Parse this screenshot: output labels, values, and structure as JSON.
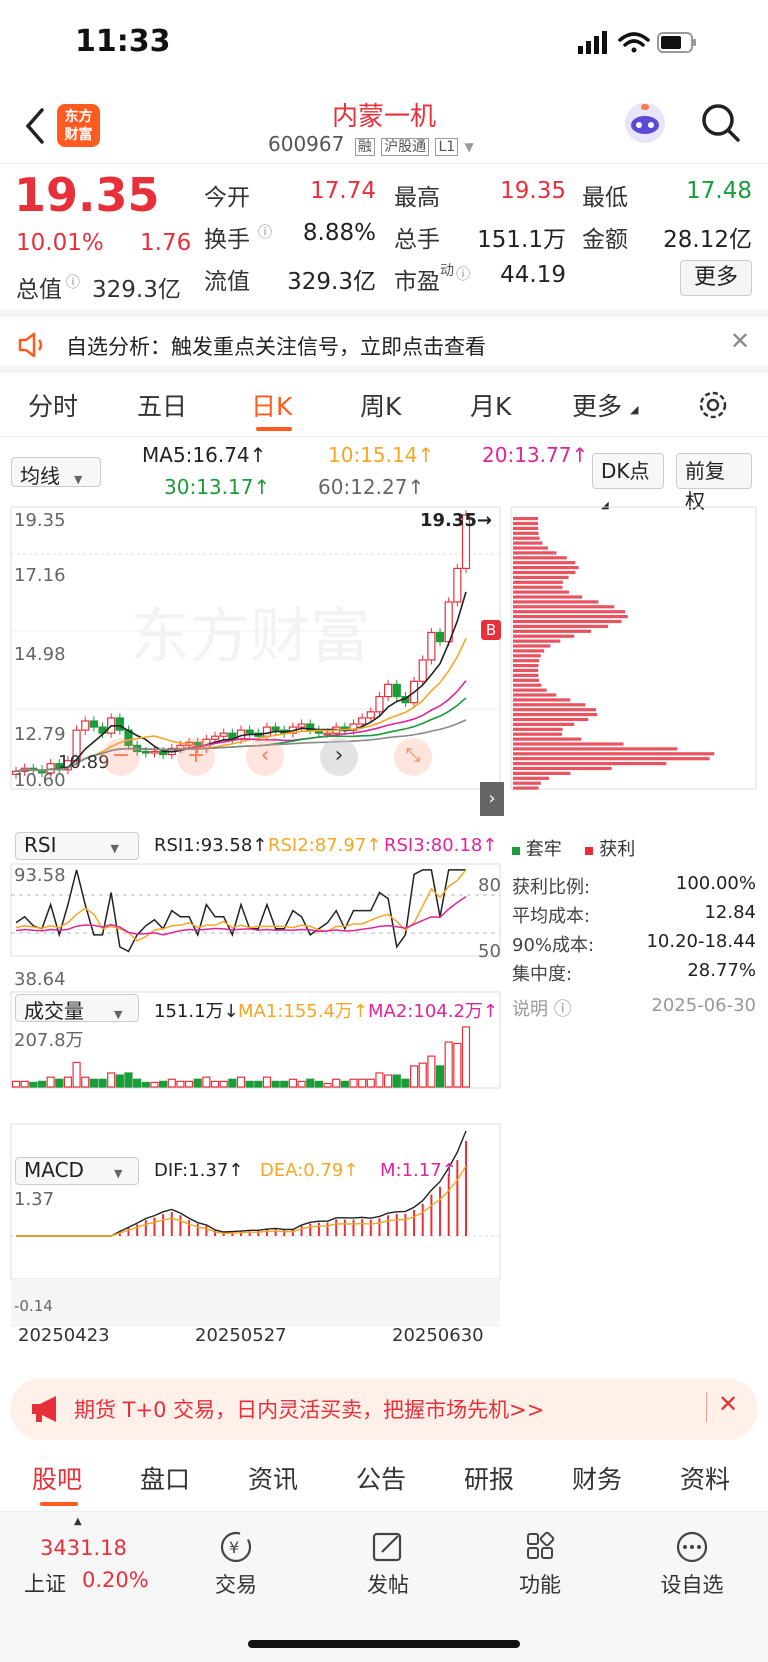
{
  "status_bar": {
    "time": "11:33"
  },
  "header": {
    "logo_text": "东方\n财富",
    "stock_name": "内蒙一机",
    "stock_code": "600967",
    "badges": [
      "融",
      "沪股通",
      "L1"
    ]
  },
  "quote": {
    "price": "19.35",
    "change_pct": "10.01%",
    "change": "1.76",
    "total_value_label": "总值",
    "total_value": "329.3亿",
    "rows": [
      [
        {
          "label": "今开",
          "value": "17.74",
          "color": "red"
        },
        {
          "label": "最高",
          "value": "19.35",
          "color": "red"
        },
        {
          "label": "最低",
          "value": "17.48",
          "color": "green"
        }
      ],
      [
        {
          "label": "换手",
          "value": "8.88%",
          "color": "dark"
        },
        {
          "label": "总手",
          "value": "151.1万",
          "color": "dark"
        },
        {
          "label": "金额",
          "value": "28.12亿",
          "color": "dark"
        }
      ],
      [
        {
          "label": "流值",
          "value": "329.3亿",
          "color": "dark"
        },
        {
          "label": "市盈",
          "value": "44.19",
          "color": "dark"
        }
      ]
    ],
    "pe_sup": "动",
    "more_label": "更多"
  },
  "notice": {
    "text": "自选分析：触发重点关注信号，立即点击查看"
  },
  "tabs": [
    "分时",
    "五日",
    "日K",
    "周K",
    "月K",
    "更多"
  ],
  "active_tab": 2,
  "ma_bar": {
    "select": "均线",
    "items": [
      {
        "text": "MA5:16.74↑",
        "color": "#222"
      },
      {
        "text": "10:15.14↑",
        "color": "#f5a623"
      },
      {
        "text": "20:13.77↑",
        "color": "#e0249c"
      },
      {
        "text": "30:13.17↑",
        "color": "#1a9c38"
      },
      {
        "text": "60:12.27↑",
        "color": "#666"
      }
    ],
    "dk_label": "DK点",
    "fq_label": "前复权"
  },
  "kline": {
    "y_labels": [
      "19.35",
      "17.16",
      "14.98",
      "12.79",
      "10.60"
    ],
    "low_mark": "10.89",
    "high_mark": "19.35→",
    "watermark": "东方财富",
    "b_marker": "B",
    "legend": [
      "套牢",
      "获利"
    ]
  },
  "chip_stats": [
    {
      "label": "获利比例:",
      "value": "100.00%"
    },
    {
      "label": "平均成本:",
      "value": "12.84"
    },
    {
      "label": "90%成本:",
      "value": "10.20-18.44"
    },
    {
      "label": "集中度:",
      "value": "28.77%"
    }
  ],
  "chip_note": {
    "label": "说明",
    "date": "2025-06-30"
  },
  "rsi": {
    "select": "RSI",
    "rsi1": "RSI1:93.58↑",
    "rsi2": "RSI2:87.97↑",
    "rsi3": "RSI3:80.18↑",
    "top": "93.58",
    "bottom": "38.64",
    "lvl80": "80",
    "lvl50": "50"
  },
  "volume": {
    "select": "成交量",
    "vol": "151.1万↓",
    "ma1": "MA1:155.4万↑",
    "ma2": "MA2:104.2万↑",
    "top": "207.8万"
  },
  "macd": {
    "select": "MACD",
    "dif": "DIF:1.37↑",
    "dea": "DEA:0.79↑",
    "m": "M:1.17↑",
    "top": "1.37",
    "bottom": "-0.14"
  },
  "dates": [
    "20250423",
    "20250527",
    "20250630"
  ],
  "promo": {
    "text": "期货 T+0 交易，日内灵活买卖，把握市场先机>>"
  },
  "bottom_tabs": [
    "股吧",
    "盘口",
    "资讯",
    "公告",
    "研报",
    "财务",
    "资料"
  ],
  "dock": {
    "index_value": "3431.18",
    "index_name": "上证",
    "index_change": "0.20%",
    "items": [
      "交易",
      "发帖",
      "功能",
      "设自选"
    ]
  },
  "colors": {
    "accent": "#ff5a1f",
    "up": "#e8303a",
    "down": "#1a9c38"
  },
  "chart_data": {
    "type": "candlestick",
    "y_range": [
      10.6,
      19.35
    ],
    "closes": [
      10.95,
      11.05,
      11.0,
      10.9,
      11.2,
      11.0,
      11.3,
      12.3,
      12.6,
      12.4,
      12.2,
      12.7,
      12.3,
      11.8,
      11.6,
      11.55,
      11.6,
      11.5,
      11.7,
      11.8,
      11.9,
      11.7,
      12.0,
      12.1,
      12.2,
      12.0,
      12.3,
      12.2,
      12.1,
      12.4,
      12.3,
      12.2,
      12.4,
      12.5,
      12.3,
      12.2,
      12.2,
      12.4,
      12.3,
      12.5,
      12.7,
      12.9,
      13.4,
      13.8,
      13.4,
      13.2,
      13.9,
      14.6,
      15.5,
      15.2,
      16.5,
      17.6,
      19.35
    ],
    "volume_last": "151.1万"
  }
}
